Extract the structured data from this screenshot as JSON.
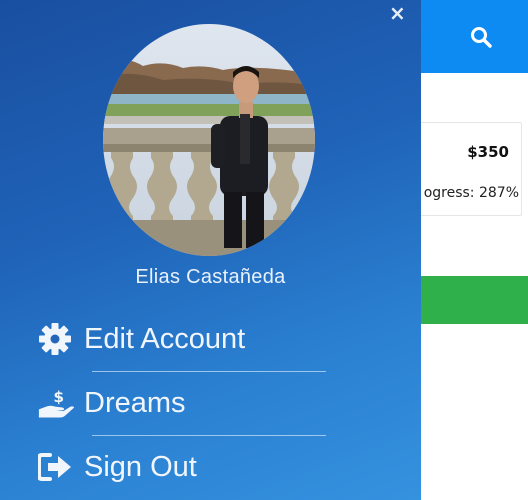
{
  "background": {
    "header": {
      "search_icon": "search-icon"
    },
    "card": {
      "amount": "$350",
      "progress": "ogress: 287%"
    }
  },
  "drawer": {
    "close_label": "×",
    "user_name": "Elias Castañeda",
    "menu": [
      {
        "label": "Edit Account",
        "icon": "gear-icon"
      },
      {
        "label": "Dreams",
        "icon": "hand-money-icon"
      },
      {
        "label": "Sign Out",
        "icon": "sign-out-icon"
      }
    ]
  },
  "colors": {
    "header": "#0d8bf2",
    "drawer_top": "#1a4fa0",
    "drawer_bottom": "#3592df",
    "green": "#2fb04a"
  }
}
